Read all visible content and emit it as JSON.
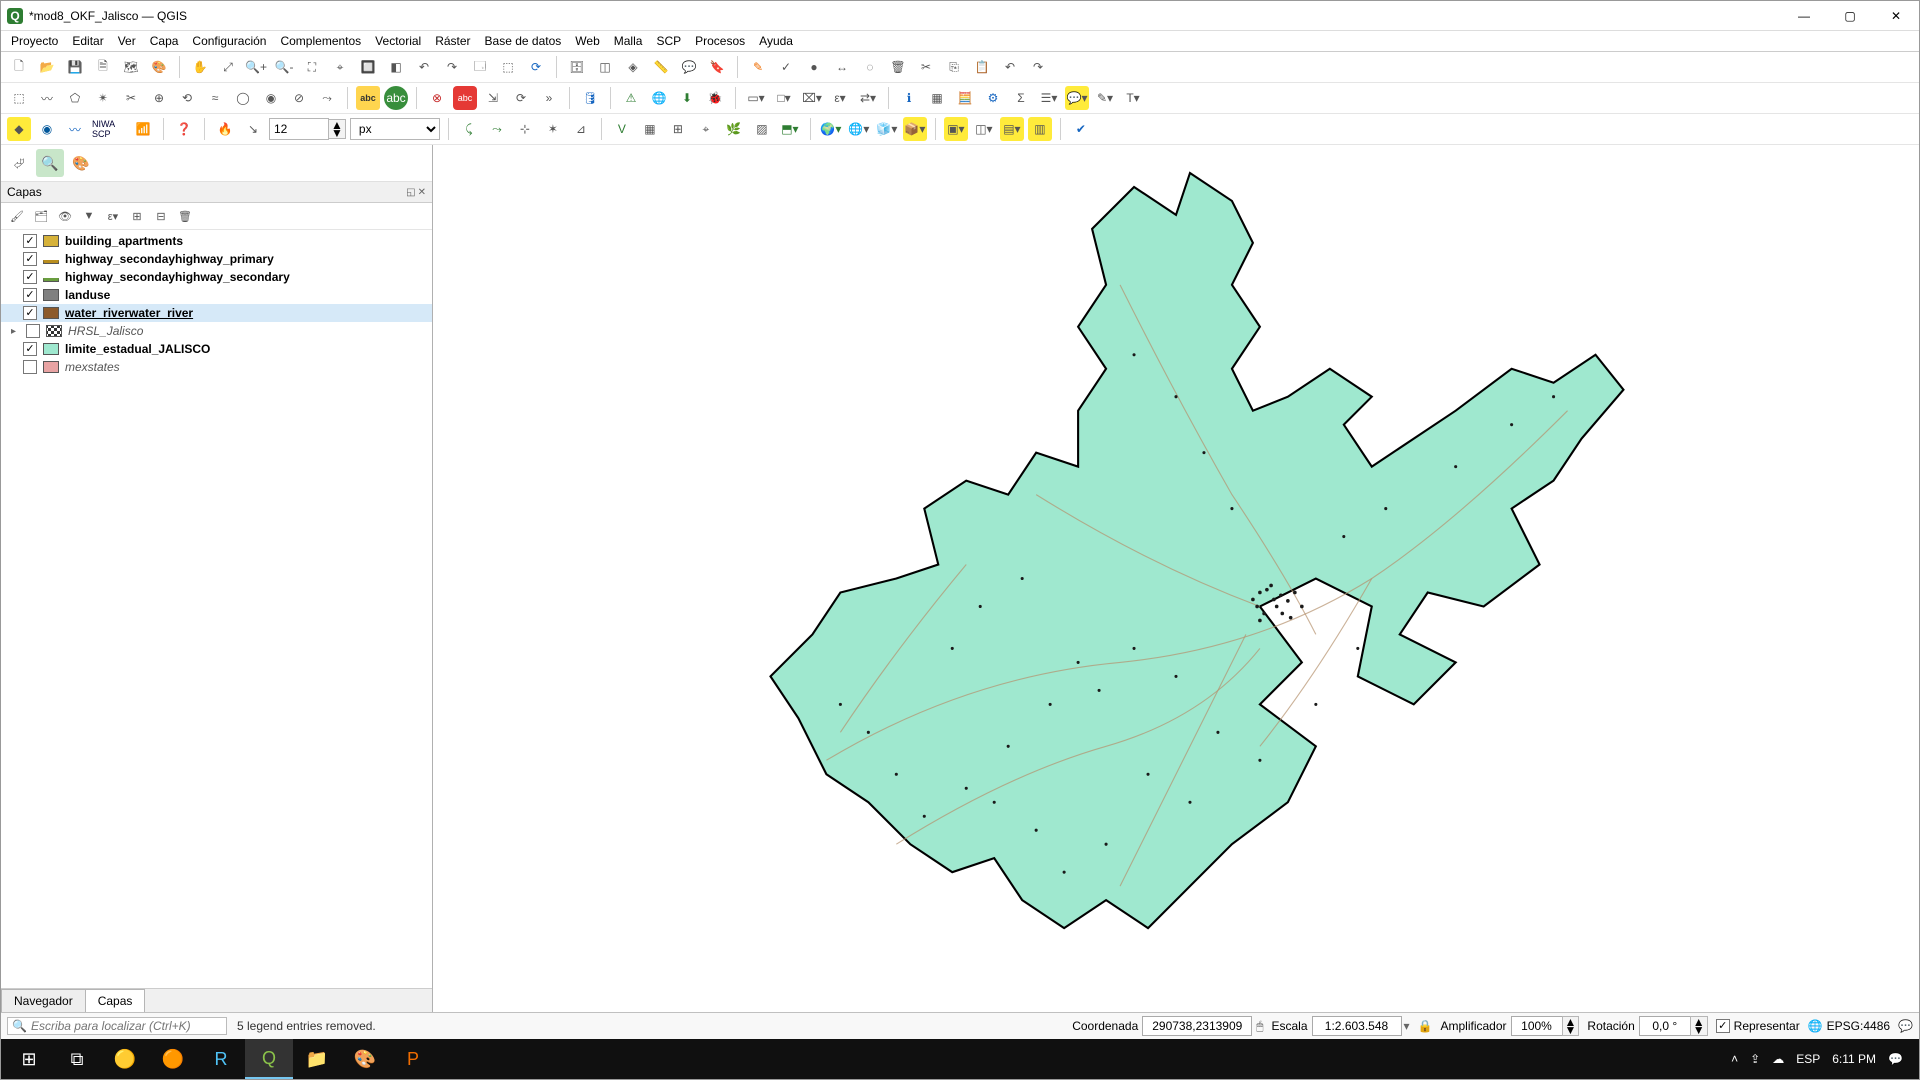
{
  "window": {
    "title": "*mod8_OKF_Jalisco — QGIS",
    "minimize": "—",
    "maximize": "▢",
    "close": "✕"
  },
  "menu": {
    "items": [
      "Proyecto",
      "Editar",
      "Ver",
      "Capa",
      "Configuración",
      "Complementos",
      "Vectorial",
      "Ráster",
      "Base de datos",
      "Web",
      "Malla",
      "SCP",
      "Procesos",
      "Ayuda"
    ]
  },
  "toolbar_inputs": {
    "size_value": "12",
    "size_unit": "px"
  },
  "left_panel": {
    "title": "Capas",
    "tab_browser": "Navegador",
    "tab_layers": "Capas"
  },
  "layers": [
    {
      "checked": true,
      "swatch": "#d6b23a",
      "name": "building_apartments",
      "bold": true
    },
    {
      "checked": true,
      "swatch_line": "#b98e1f",
      "name": "highway_secondayhighway_primary",
      "bold": true
    },
    {
      "checked": true,
      "swatch_line": "#6a9e3f",
      "name": "highway_secondayhighway_secondary",
      "bold": true
    },
    {
      "checked": true,
      "swatch": "#808080",
      "name": "landuse",
      "bold": true
    },
    {
      "checked": true,
      "swatch": "#8c5a2b",
      "name": "water_riverwater_river",
      "bold": true,
      "underline": true,
      "selected": true
    },
    {
      "checked": false,
      "swatch_pattern": true,
      "name": "HRSL_Jalisco",
      "italic": true,
      "expandable": true
    },
    {
      "checked": true,
      "swatch": "#9fe8cf",
      "name": "limite_estadual_JALISCO",
      "bold": true
    },
    {
      "checked": false,
      "swatch": "#e8a3a3",
      "name": "mexstates",
      "italic": true
    }
  ],
  "statusbar": {
    "locator_placeholder": "Escriba para localizar (Ctrl+K)",
    "message": "5 legend entries removed.",
    "coord_label": "Coordenada",
    "coord_value": "290738,2313909",
    "scale_label": "Escala",
    "scale_value": "1:2.603.548",
    "amplifier_label": "Amplificador",
    "amplifier_value": "100%",
    "rotation_label": "Rotación",
    "rotation_value": "0,0 °",
    "render_label": "Representar",
    "crs": "EPSG:4486"
  },
  "taskbar": {
    "lang": "ESP",
    "time": "6:11 PM"
  }
}
